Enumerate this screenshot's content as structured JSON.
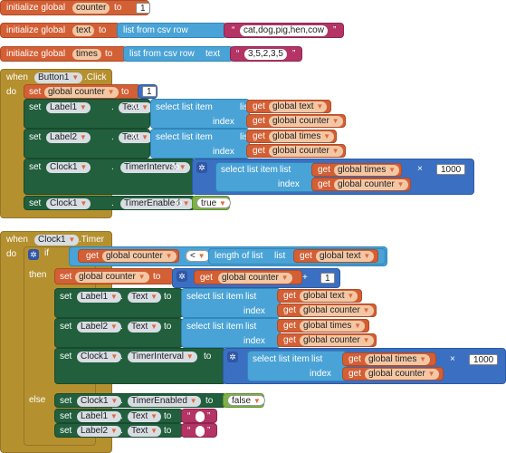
{
  "globals": [
    {
      "keyword": "initialize global",
      "name": "counter",
      "to": "to",
      "value": "1"
    },
    {
      "keyword": "initialize global",
      "name": "text",
      "to": "to",
      "func": "list from csv row",
      "param": "text",
      "quote_open": "“",
      "value": "cat,dog,pig,hen,cow",
      "quote_close": "”"
    },
    {
      "keyword": "initialize global",
      "name": "times",
      "to": "to",
      "func": "list from csv row",
      "param": "text",
      "quote_open": "“",
      "value": "3,5,2,3,5",
      "quote_close": "”"
    }
  ],
  "words": {
    "when": "when",
    "do": "do",
    "set": "set",
    "to": "to",
    "get": "get",
    "if": "if",
    "then": "then",
    "else": "else",
    "dot": ".",
    "select_list_item": "select list item",
    "list": "list",
    "index": "index",
    "length_of_list": "length of list",
    "times_op": "×",
    "plus_op": "+",
    "lt_op": "<",
    "quote_open": "“",
    "quote_close": "”"
  },
  "event1": {
    "component": "Button1",
    "event": ".Click",
    "set_counter": {
      "var": "global counter",
      "value": "1"
    },
    "label1": {
      "component": "Label1",
      "prop": "Text",
      "list": "global text",
      "index": "global counter"
    },
    "label2": {
      "component": "Label2",
      "prop": "Text",
      "list": "global times",
      "index": "global counter"
    },
    "clock_interval": {
      "component": "Clock1",
      "prop": "TimerInterval",
      "list": "global times",
      "index": "global counter",
      "multiplier": "1000"
    },
    "clock_enabled": {
      "component": "Clock1",
      "prop": "TimerEnabled",
      "value": "true"
    }
  },
  "event2": {
    "component": "Clock1",
    "event": ".Timer",
    "cond_left": "global counter",
    "cond_right": "global text",
    "set_counter": {
      "var": "global counter",
      "get": "global counter",
      "add": "1"
    },
    "label1": {
      "component": "Label1",
      "prop": "Text",
      "list": "global text",
      "index": "global counter"
    },
    "label2": {
      "component": "Label2",
      "prop": "Text",
      "list": "global times",
      "index": "global counter"
    },
    "clock_interval": {
      "component": "Clock1",
      "prop": "TimerInterval",
      "list": "global times",
      "index": "global counter",
      "multiplier": "1000"
    },
    "else_enabled": {
      "component": "Clock1",
      "prop": "TimerEnabled",
      "value": "false"
    },
    "else_label1": {
      "component": "Label1",
      "prop": "Text",
      "value": ""
    },
    "else_label2": {
      "component": "Label2",
      "prop": "Text",
      "value": ""
    }
  }
}
